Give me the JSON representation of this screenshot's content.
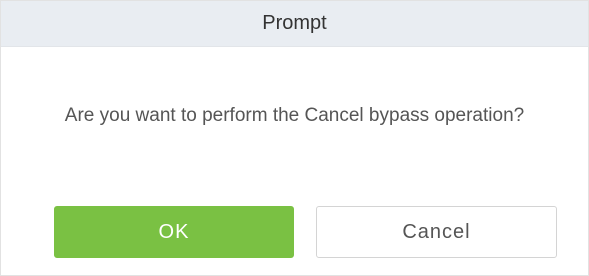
{
  "dialog": {
    "title": "Prompt",
    "message": "Are you want to perform the Cancel bypass operation?",
    "ok_label": "OK",
    "cancel_label": "Cancel"
  },
  "colors": {
    "header_bg": "#e9edf2",
    "ok_bg": "#7ac143",
    "ok_text": "#ffffff",
    "cancel_border": "#d4d4d4",
    "text": "#555555"
  }
}
